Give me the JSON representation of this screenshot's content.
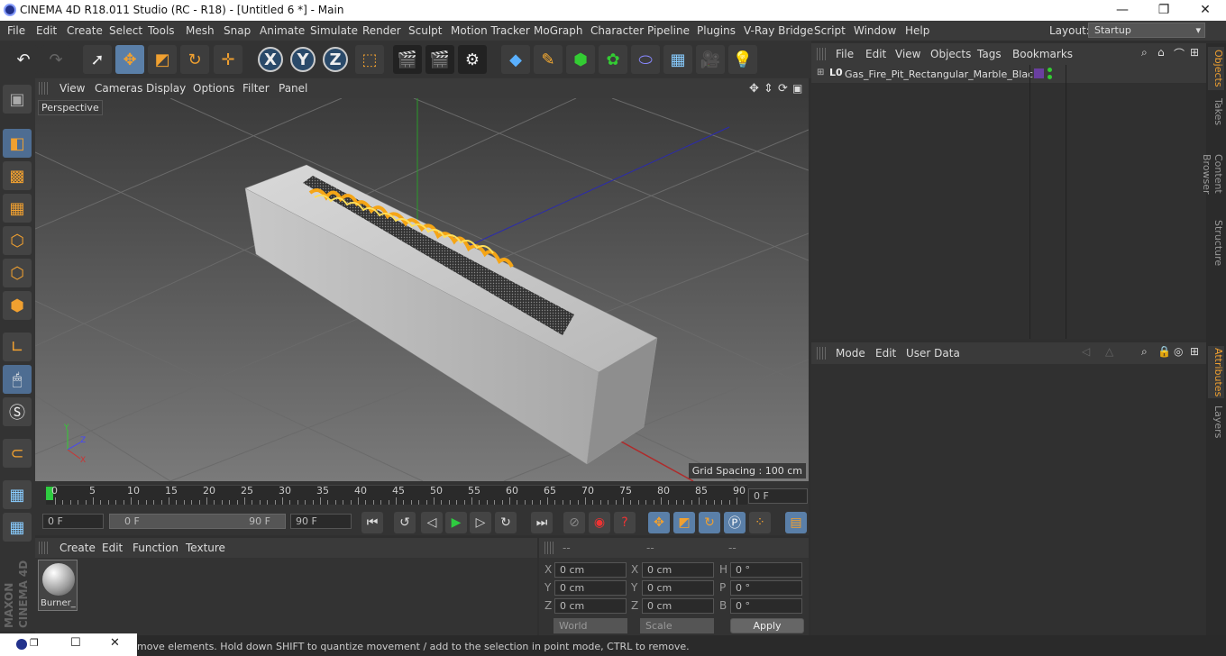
{
  "titlebar": {
    "title": "CINEMA 4D R18.011 Studio (RC - R18) - [Untitled 6 *] - Main",
    "minimize": "—",
    "maximize": "❐",
    "close": "✕"
  },
  "menubar": {
    "items": [
      "File",
      "Edit",
      "Create",
      "Select",
      "Tools",
      "Mesh",
      "Snap",
      "Animate",
      "Simulate",
      "Render",
      "Sculpt",
      "Motion Tracker",
      "MoGraph",
      "Character",
      "Pipeline",
      "Plugins",
      "V-Ray Bridge",
      "Script",
      "Window",
      "Help"
    ],
    "layout_label": "Layout:",
    "layout_value": "Startup"
  },
  "viewport": {
    "menu": [
      "View",
      "Cameras",
      "Display",
      "Options",
      "Filter",
      "Panel"
    ],
    "camera_label": "Perspective",
    "grid_spacing": "Grid Spacing : 100 cm"
  },
  "timeline": {
    "ticks": [
      "0",
      "5",
      "10",
      "15",
      "20",
      "25",
      "30",
      "35",
      "40",
      "45",
      "50",
      "55",
      "60",
      "65",
      "70",
      "75",
      "80",
      "85",
      "90"
    ],
    "current_frame": "0 F"
  },
  "transport": {
    "start_field": "0 F",
    "range_start": "0 F",
    "range_end": "90 F",
    "end_field": "90 F"
  },
  "materials": {
    "menu": [
      "Create",
      "Edit",
      "Function",
      "Texture"
    ],
    "items": [
      {
        "name": "Burner_"
      }
    ]
  },
  "coordinates": {
    "headers": [
      "--",
      "--",
      "--"
    ],
    "pos": [
      {
        "axis": "X",
        "value": "0 cm"
      },
      {
        "axis": "Y",
        "value": "0 cm"
      },
      {
        "axis": "Z",
        "value": "0 cm"
      }
    ],
    "size": [
      {
        "axis": "X",
        "value": "0 cm"
      },
      {
        "axis": "Y",
        "value": "0 cm"
      },
      {
        "axis": "Z",
        "value": "0 cm"
      }
    ],
    "rot": [
      {
        "axis": "H",
        "value": "0 °"
      },
      {
        "axis": "P",
        "value": "0 °"
      },
      {
        "axis": "B",
        "value": "0 °"
      }
    ],
    "world": "World",
    "scale": "Scale",
    "apply": "Apply"
  },
  "objects": {
    "menu": [
      "File",
      "Edit",
      "View",
      "Objects",
      "Tags",
      "Bookmarks"
    ],
    "rows": [
      {
        "name": "Gas_Fire_Pit_Rectangular_Marble_Black",
        "layer": "L0"
      }
    ]
  },
  "attributes": {
    "menu": [
      "Mode",
      "Edit",
      "User Data"
    ]
  },
  "right_tabs": {
    "top": [
      "Objects",
      "Takes",
      "Content Browser",
      "Structure"
    ],
    "bottom": [
      "Attributes",
      "Layers"
    ]
  },
  "status": {
    "text": "move elements. Hold down SHIFT to quantize movement / add to the selection in point mode, CTRL to remove."
  },
  "colors": {
    "accent": "#f0a030",
    "select_blue": "#5a7fa8",
    "play_green": "#2ecc40"
  }
}
